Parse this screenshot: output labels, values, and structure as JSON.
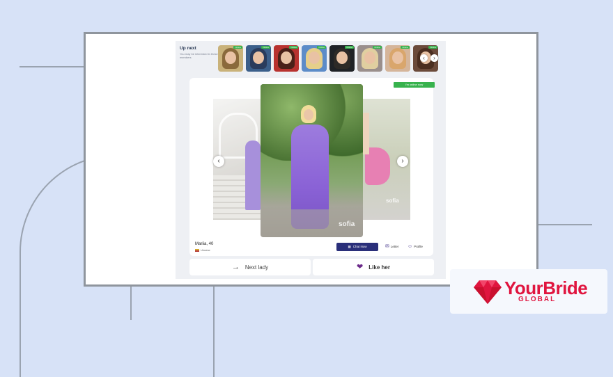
{
  "upnext": {
    "title": "Up next",
    "subtitle": "You may be interested in these members",
    "online_badge": "Online",
    "thumbs": [
      {
        "name": "thumb-1"
      },
      {
        "name": "thumb-2"
      },
      {
        "name": "thumb-3"
      },
      {
        "name": "thumb-4"
      },
      {
        "name": "thumb-5"
      },
      {
        "name": "thumb-6"
      },
      {
        "name": "thumb-7"
      },
      {
        "name": "thumb-8"
      }
    ]
  },
  "profile": {
    "online_status": "I'm online now",
    "name_age": "Mariia, 40",
    "country": "Ukraine",
    "watermark": "sofia"
  },
  "actions": {
    "chat": "Chat Now",
    "letter": "Letter",
    "profile": "Profile"
  },
  "bottom": {
    "next": "Next lady",
    "like": "Like her"
  },
  "brand": {
    "title": "YourBride",
    "subtitle": "GLOBAL"
  },
  "colors": {
    "accent": "#e0153f",
    "online": "#37b24d",
    "chat_button": "#2a2f7a",
    "heart": "#6b2a8a",
    "background": "#d7e2f7"
  },
  "icons": [
    "chevron-left-icon",
    "chevron-right-icon",
    "chat-icon",
    "envelope-icon",
    "user-icon",
    "arrow-right-icon",
    "heart-icon",
    "diamond-logo-icon"
  ]
}
